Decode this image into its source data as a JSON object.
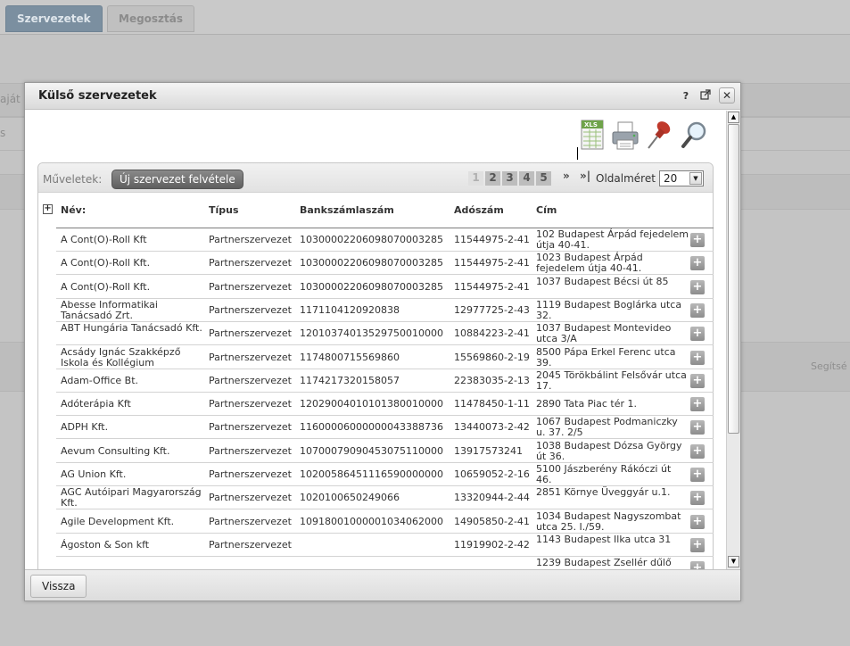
{
  "background": {
    "tabs": [
      {
        "label": "Szervezetek",
        "active": true
      },
      {
        "label": "Megosztás",
        "active": false
      }
    ],
    "faded_left_1": "aját",
    "faded_left_2": "s",
    "faded_right": "Segítsé"
  },
  "modal": {
    "title": "Külső szervezetek",
    "help_label": "?",
    "toolbar_icons": [
      "xls-export-icon",
      "printer-icon",
      "pin-icon",
      "search-icon"
    ],
    "operations_label": "Műveletek:",
    "new_button_label": "Új szervezet felvétele",
    "pager": {
      "pages": [
        "1",
        "2",
        "3",
        "4",
        "5"
      ],
      "current_page": "1",
      "next_label": "»",
      "last_label": "»|"
    },
    "page_size_label": "Oldalméret",
    "page_size_value": "20",
    "columns": {
      "name": "Név:",
      "type": "Típus",
      "bank": "Bankszámlaszám",
      "tax": "Adószám",
      "address": "Cím"
    },
    "rows": [
      {
        "name": "A Cont(O)-Roll Kft",
        "type": "Partnerszervezet",
        "bank": "10300002206098070003285",
        "tax": "11544975-2-41",
        "address": "102 Budapest Árpád fejedelem útja 40-41."
      },
      {
        "name": "A Cont(O)-Roll Kft.",
        "type": "Partnerszervezet",
        "bank": "10300002206098070003285",
        "tax": "11544975-2-41",
        "address": "1023 Budapest Árpád fejedelem útja 40-41."
      },
      {
        "name": "A Cont(O)-Roll Kft.",
        "type": "Partnerszervezet",
        "bank": "10300002206098070003285",
        "tax": "11544975-2-41",
        "address": "1037 Budapest Bécsi út 85"
      },
      {
        "name": "Abesse Informatikai Tanácsadó Zrt.",
        "type": "Partnerszervezet",
        "bank": "1171104120920838",
        "tax": "12977725-2-43",
        "address": "1119 Budapest Boglárka utca 32."
      },
      {
        "name": "ABT Hungária Tanácsadó Kft.",
        "type": "Partnerszervezet",
        "bank": "12010374013529750010000",
        "tax": "10884223-2-41",
        "address": "1037 Budapest Montevideo utca 3/A"
      },
      {
        "name": "Acsády Ignác Szakképző Iskola és Kollégium",
        "type": "Partnerszervezet",
        "bank": "1174800715569860",
        "tax": "15569860-2-19",
        "address": "8500 Pápa Erkel Ferenc utca 39."
      },
      {
        "name": "Adam-Office Bt.",
        "type": "Partnerszervezet",
        "bank": "1174217320158057",
        "tax": "22383035-2-13",
        "address": "2045 Törökbálint Felsővár utca 17."
      },
      {
        "name": "Adóterápia Kft",
        "type": "Partnerszervezet",
        "bank": "12029004010101380010000",
        "tax": "11478450-1-11",
        "address": "2890 Tata Piac tér 1."
      },
      {
        "name": "ADPH Kft.",
        "type": "Partnerszervezet",
        "bank": "11600006000000043388736",
        "tax": "13440073-2-42",
        "address": "1067 Budapest Podmaniczky u. 37. 2/5"
      },
      {
        "name": "Aevum Consulting Kft.",
        "type": "Partnerszervezet",
        "bank": "10700079090453075110000",
        "tax": "13917573241",
        "address": "1038 Budapest Dózsa György út 36."
      },
      {
        "name": "AG Union Kft.",
        "type": "Partnerszervezet",
        "bank": "10200586451116590000000",
        "tax": "10659052-2-16",
        "address": "5100 Jászberény Rákóczi út 46."
      },
      {
        "name": "AGC Autóipari Magyarország Kft.",
        "type": "Partnerszervezet",
        "bank": "1020100650249066",
        "tax": "13320944-2-44",
        "address": "2851 Környe Üveggyár u.1."
      },
      {
        "name": "Agile Development Kft.",
        "type": "Partnerszervezet",
        "bank": "10918001000001034062000",
        "tax": "14905850-2-41",
        "address": "1034 Budapest Nagyszombat utca 25. I./59."
      },
      {
        "name": "Ágoston & Son kft",
        "type": "Partnerszervezet",
        "bank": "",
        "tax": "11919902-2-42",
        "address": "1143 Budapest Ilka utca 31"
      },
      {
        "name": "",
        "type": "",
        "bank": "",
        "tax": "",
        "address": "1239 Budapest Zsellér dűlő"
      }
    ],
    "back_button_label": "Vissza"
  }
}
